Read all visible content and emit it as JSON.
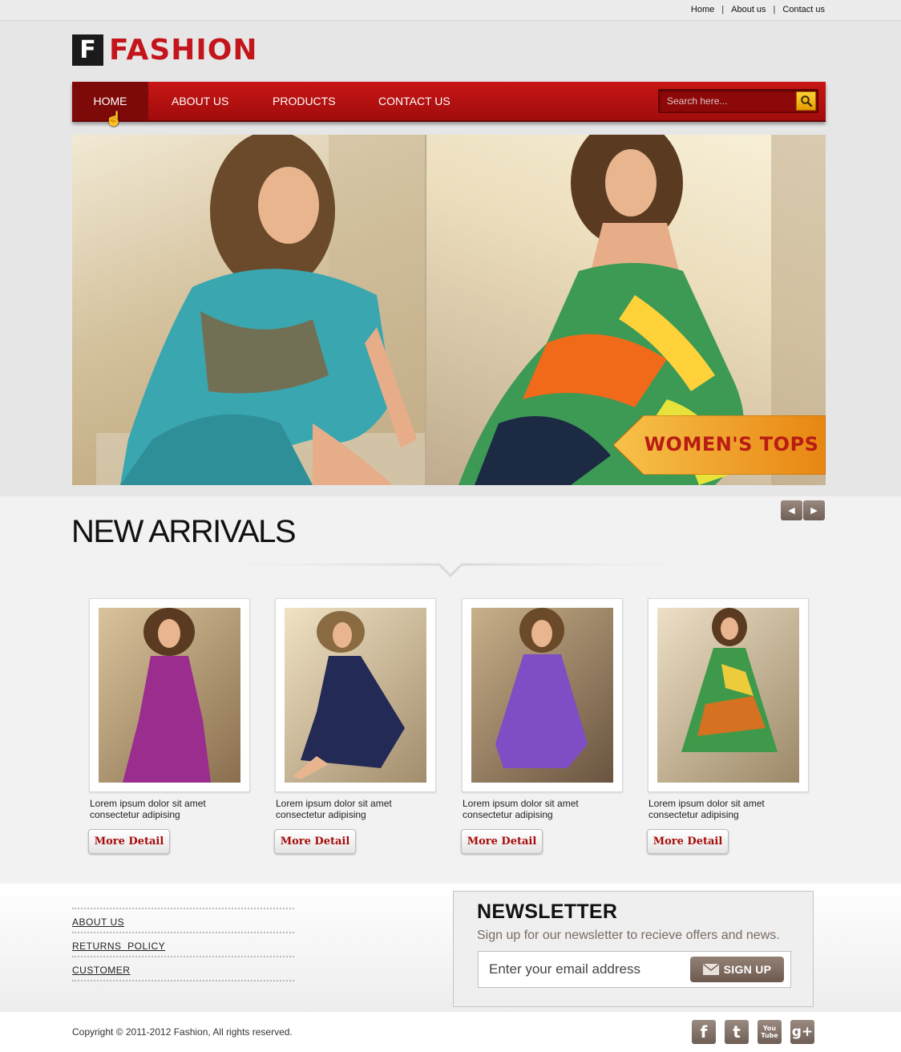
{
  "top_links": [
    "Home",
    "About us",
    "Contact us"
  ],
  "logo": {
    "letter": "F",
    "text": "FASHION"
  },
  "nav": {
    "items": [
      "HOME",
      "ABOUT US",
      "PRODUCTS",
      "CONTACT US"
    ],
    "active": "HOME"
  },
  "search": {
    "placeholder": "Search here..."
  },
  "hero": {
    "badge": "WOMEN'S TOPS"
  },
  "new_arrivals": {
    "title": "NEW ARRIVALS",
    "products": [
      {
        "desc": "Lorem ipsum dolor sit amet consectetur adipising",
        "button": "More Detail",
        "dress_color": "#9b2d8e"
      },
      {
        "desc": "Lorem ipsum dolor sit amet consectetur adipising",
        "button": "More Detail",
        "dress_color": "#232a55"
      },
      {
        "desc": "Lorem ipsum dolor sit amet consectetur adipising",
        "button": "More Detail",
        "dress_color": "#7f4ec4"
      },
      {
        "desc": "Lorem ipsum dolor sit amet consectetur adipising",
        "button": "More Detail",
        "dress_color": "#3e9a4a"
      }
    ]
  },
  "footer": {
    "links": [
      "ABOUT US",
      "RETURNS  POLICY",
      "CUSTOMER"
    ],
    "newsletter": {
      "title": "NEWSLETTER",
      "subtitle": "Sign up for our newsletter to recieve offers and news.",
      "placeholder": "Enter your email address",
      "button": "SIGN UP"
    },
    "copyright": "Copyright © 2011-2012 Fashion, All rights reserved.",
    "social": [
      {
        "icon": "facebook-icon",
        "glyph": "f"
      },
      {
        "icon": "twitter-icon",
        "glyph": "t"
      },
      {
        "icon": "youtube-icon",
        "glyph": "You Tube"
      },
      {
        "icon": "google-plus-icon",
        "glyph": "g+"
      }
    ]
  },
  "colors": {
    "brand_red": "#c3161c",
    "nav_red": "#b31010",
    "accent_orange": "#f0a020",
    "muted_brown": "#7a6b63"
  }
}
